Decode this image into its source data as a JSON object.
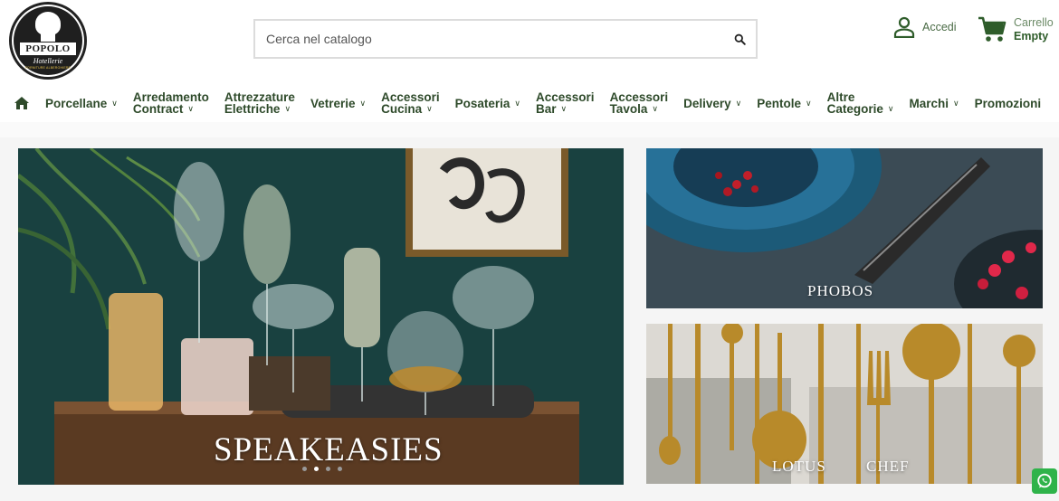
{
  "logo": {
    "name": "POPOLO",
    "sub": "Hotellerie",
    "tagline": "FORNITURE ALBERGHIERE"
  },
  "search": {
    "placeholder": "Cerca nel catalogo",
    "icon": "search-icon"
  },
  "account": {
    "label": "Accedi",
    "icon": "user-icon"
  },
  "cart": {
    "title": "Carrello",
    "value": "Empty",
    "icon": "cart-icon"
  },
  "nav": {
    "home_icon": "home-icon",
    "items": [
      {
        "line1": "Porcellane",
        "line2": ""
      },
      {
        "line1": "Arredamento",
        "line2": "Contract"
      },
      {
        "line1": "Attrezzature",
        "line2": "Elettriche"
      },
      {
        "line1": "Vetrerie",
        "line2": ""
      },
      {
        "line1": "Accessori",
        "line2": "Cucina"
      },
      {
        "line1": "Posateria",
        "line2": ""
      },
      {
        "line1": "Accessori",
        "line2": "Bar"
      },
      {
        "line1": "Accessori",
        "line2": "Tavola"
      },
      {
        "line1": "Delivery",
        "line2": ""
      },
      {
        "line1": "Pentole",
        "line2": ""
      },
      {
        "line1": "Altre",
        "line2": "Categorie"
      },
      {
        "line1": "Marchi",
        "line2": ""
      },
      {
        "line1": "Promozioni",
        "line2": ""
      }
    ]
  },
  "banners": {
    "main_caption": "SPEAKEASIES",
    "side1_caption": "PHOBOS",
    "side2_caption_left": "LOTUS",
    "side2_caption_right": "CHEF",
    "slider_dots": 4,
    "active_dot": 1
  },
  "colors": {
    "nav_text": "#2e4a2a",
    "accent_green": "#2e5c2a",
    "whatsapp": "#2fb34a"
  }
}
